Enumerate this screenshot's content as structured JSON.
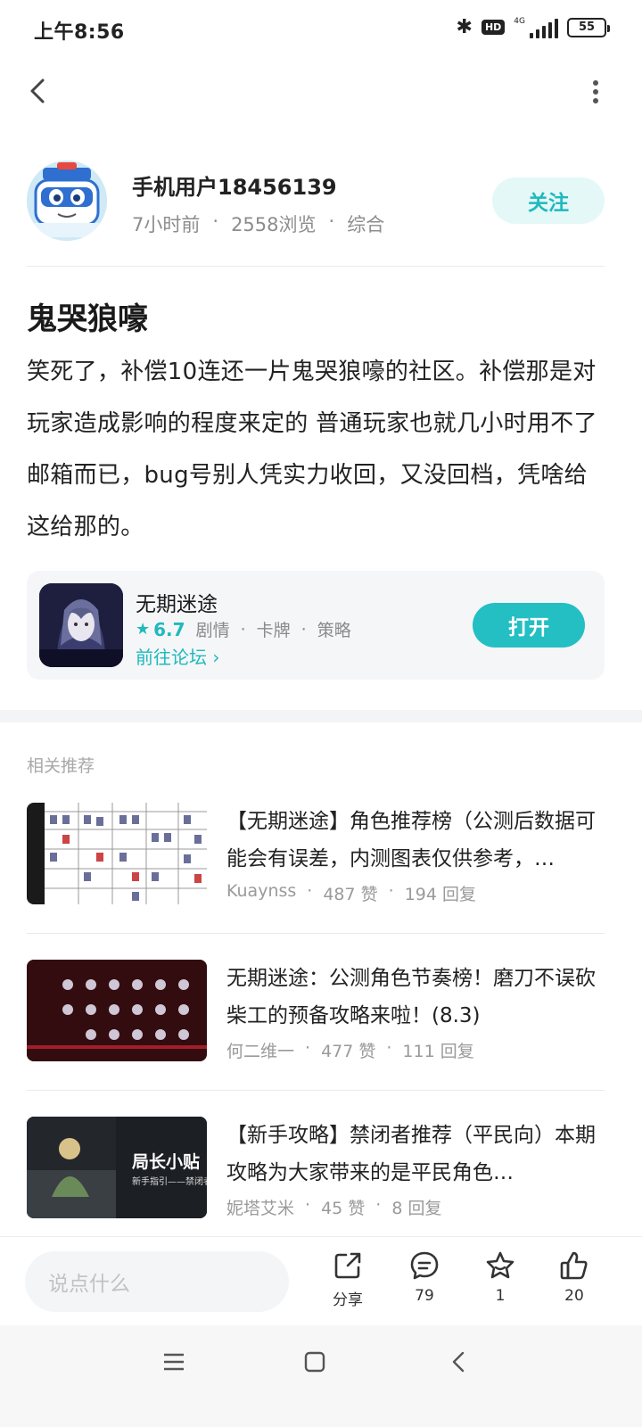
{
  "status_bar": {
    "time": "上午8:56",
    "hd": "HD",
    "network": "4G",
    "battery": "55"
  },
  "author": {
    "name": "手机用户18456139",
    "time_ago": "7小时前",
    "views": "2558浏览",
    "category": "综合",
    "follow_label": "关注"
  },
  "post": {
    "title": "鬼哭狼嚎",
    "body": "笑死了，补偿10连还一片鬼哭狼嚎的社区。补偿那是对玩家造成影响的程度来定的 普通玩家也就几小时用不了邮箱而已，bug号别人凭实力收回，又没回档，凭啥给这给那的。"
  },
  "game_card": {
    "name": "无期迷途",
    "rating": "6.7",
    "tags": [
      "剧情",
      "卡牌",
      "策略"
    ],
    "forum_link": "前往论坛",
    "open_label": "打开"
  },
  "recommendations": {
    "title": "相关推荐",
    "items": [
      {
        "headline": "【无期迷途】角色推荐榜（公测后数据可能会有误差，内测图表仅供参考，…",
        "author": "Kuaynss",
        "likes": "487 赞",
        "replies": "194 回复"
      },
      {
        "headline": "无期迷途：公测角色节奏榜！磨刀不误砍柴工的预备攻略来啦！(8.3)",
        "author": "何二维一",
        "likes": "477 赞",
        "replies": "111 回复"
      },
      {
        "headline": "【新手攻略】禁闭者推荐（平民向）本期攻略为大家带来的是平民角色…",
        "author": "妮塔艾米",
        "likes": "45 赞",
        "replies": "8 回复"
      }
    ]
  },
  "thumb_texts": {
    "third_banner": "局长小贴",
    "third_sub": "新手指引——禁闭者"
  },
  "bottom_bar": {
    "placeholder": "说点什么",
    "share_label": "分享",
    "comments_count": "79",
    "favorites_count": "1",
    "likes_count": "20"
  },
  "colors": {
    "accent": "#23bfc3",
    "follow_bg": "#e4f8f8"
  }
}
